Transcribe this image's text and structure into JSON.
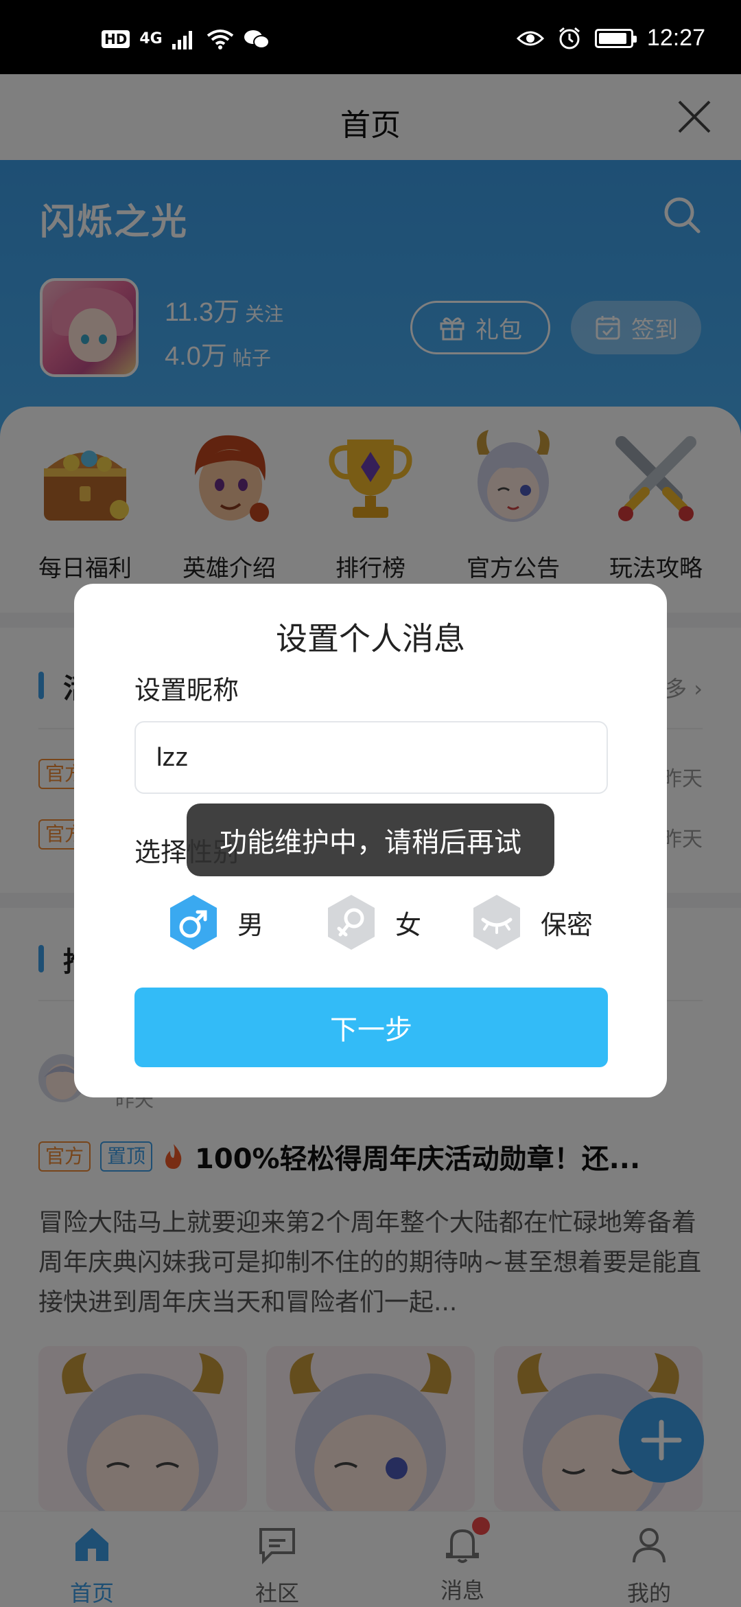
{
  "status_bar": {
    "hd": "HD",
    "network": "4G",
    "time": "12:27",
    "battery_level": 0.9
  },
  "header": {
    "title": "首页"
  },
  "banner": {
    "game_name": "闪烁之光",
    "followers": {
      "value": "11.3万",
      "label": "关注"
    },
    "posts": {
      "value": "4.0万",
      "label": "帖子"
    },
    "gift_label": "礼包",
    "signin_label": "签到"
  },
  "shortcuts": [
    {
      "label": "每日福利",
      "icon": "treasure-chest-icon"
    },
    {
      "label": "英雄介绍",
      "icon": "hero-portrait-icon"
    },
    {
      "label": "排行榜",
      "icon": "trophy-icon"
    },
    {
      "label": "官方公告",
      "icon": "announcer-girl-icon"
    },
    {
      "label": "玩法攻略",
      "icon": "crossed-swords-icon"
    }
  ],
  "news": {
    "section_title_partial": "活",
    "more_label": "多",
    "rows": [
      {
        "tag": "官方",
        "date": "昨天"
      },
      {
        "tag": "官方",
        "date": "昨天"
      }
    ]
  },
  "post": {
    "section_title_partial": "推",
    "author_sub": "昨天",
    "tags": [
      "官方",
      "置顶"
    ],
    "title": "100%轻松得周年庆活动勋章！还...",
    "body": "冒险大陆马上就要迎来第2个周年整个大陆都在忙碌地筹备着周年庆典闪妹我可是抑制不住的的期待呐~甚至想着要是能直接快进到周年庆当天和冒险者们一起..."
  },
  "bottom_nav": [
    {
      "label": "首页",
      "active": true
    },
    {
      "label": "社区",
      "active": false
    },
    {
      "label": "消息",
      "active": false,
      "badge": true
    },
    {
      "label": "我的",
      "active": false
    }
  ],
  "dialog": {
    "title": "设置个人消息",
    "nickname_label": "设置昵称",
    "nickname_value": "lzz",
    "gender_label": "选择性别",
    "genders": [
      {
        "label": "男",
        "selected": true
      },
      {
        "label": "女",
        "selected": false
      },
      {
        "label": "保密",
        "selected": false
      }
    ],
    "next_label": "下一步"
  },
  "toast": {
    "message": "功能维护中，请稍后再试"
  },
  "colors": {
    "brand_blue": "#3d9ee8",
    "button_blue": "#33bbf7",
    "tag_orange": "#f08a34",
    "badge_red": "#f04848"
  }
}
